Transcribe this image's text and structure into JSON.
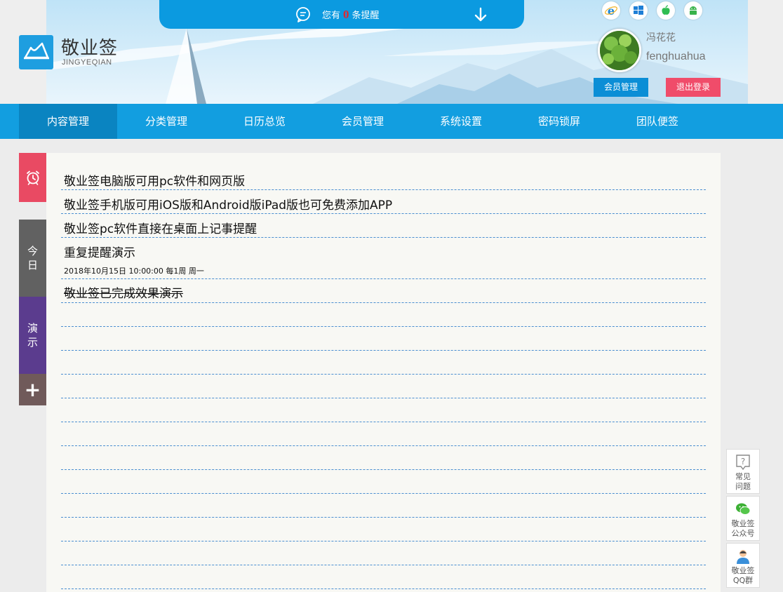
{
  "header": {
    "logo_title": "敬业签",
    "logo_subtitle": "JINGYEQIAN",
    "reminder_prefix": "您有",
    "reminder_count": "0",
    "reminder_suffix": "条提醒",
    "platforms": [
      "ie-icon",
      "windows-icon",
      "apple-icon",
      "android-icon"
    ]
  },
  "user": {
    "name_cn": "冯花花",
    "name_en": "fenghuahua",
    "member_btn": "会员管理",
    "logout_btn": "退出登录"
  },
  "nav": {
    "items": [
      {
        "label": "内容管理",
        "active": true
      },
      {
        "label": "分类管理",
        "active": false
      },
      {
        "label": "日历总览",
        "active": false
      },
      {
        "label": "会员管理",
        "active": false
      },
      {
        "label": "系统设置",
        "active": false
      },
      {
        "label": "密码锁屏",
        "active": false
      },
      {
        "label": "团队便签",
        "active": false
      }
    ]
  },
  "sidebar": {
    "today_label": "今日",
    "demo_label": "演示",
    "add_label": "+"
  },
  "notes": [
    {
      "text": "敬业签电脑版可用pc软件和网页版"
    },
    {
      "text": "敬业签手机版可用iOS版和Android版iPad版也可免费添加APP"
    },
    {
      "text": "敬业签pc软件直接在桌面上记事提醒"
    },
    {
      "text": "重复提醒演示",
      "sub": "2018年10月15日 10:00:00 每1周 周一"
    },
    {
      "text": "敬业签已完成效果演示",
      "completed": true
    }
  ],
  "helpers": [
    {
      "label1": "常见",
      "label2": "问题"
    },
    {
      "label1": "敬业签",
      "label2": "公众号"
    },
    {
      "label1": "敬业签",
      "label2": "QQ群"
    }
  ],
  "colors": {
    "primary": "#129ee0",
    "nav_active": "#0a84c1",
    "logout": "#f04c6a",
    "alarm_tab": "#e94a63",
    "today_tab": "#616161",
    "demo_tab": "#5b3c8e",
    "add_tab": "#705a5a"
  }
}
